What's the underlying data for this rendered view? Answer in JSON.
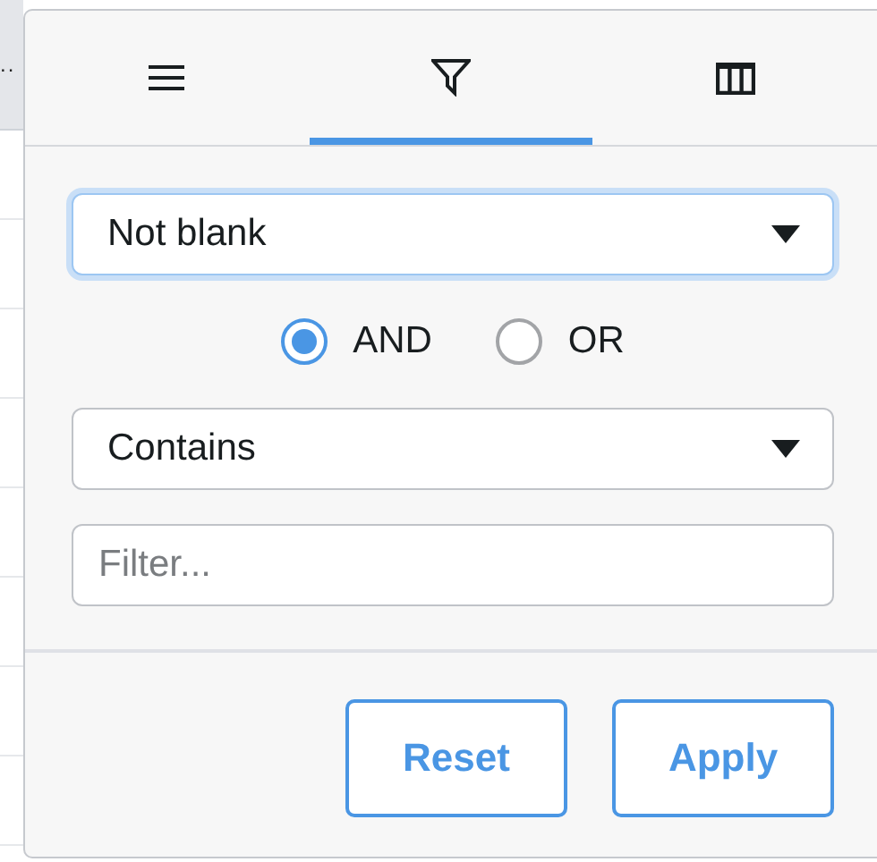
{
  "grid_behind": {
    "header_text": ".."
  },
  "tabs": [
    {
      "kind": "menu",
      "selected": false
    },
    {
      "kind": "filter",
      "selected": true
    },
    {
      "kind": "columns",
      "selected": false
    }
  ],
  "condition_1": {
    "value": "Not blank",
    "focused": true
  },
  "join_operator": [
    {
      "label": "AND",
      "selected": true
    },
    {
      "label": "OR",
      "selected": false
    }
  ],
  "condition_2": {
    "value": "Contains",
    "focused": false
  },
  "filter_field": {
    "placeholder": "Filter..."
  },
  "buttons": [
    "Reset",
    "Apply"
  ]
}
